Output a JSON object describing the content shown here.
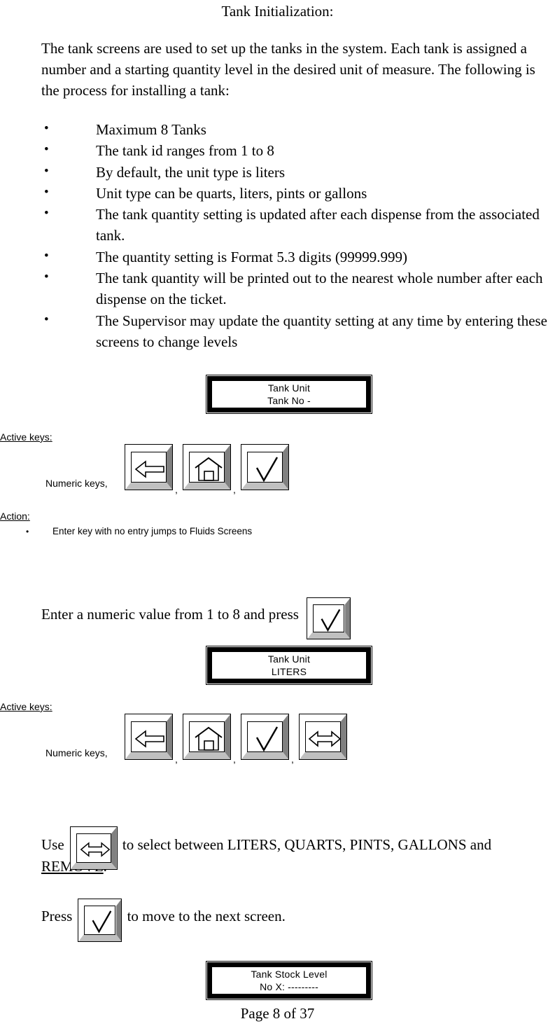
{
  "page": {
    "title": "Tank Initialization:",
    "intro": "The tank screens are used to set up the tanks in the system.  Each tank is assigned a number and a starting quantity level in the desired unit of measure.  The following is the process for installing a tank:",
    "footer": "Page 8 of 37"
  },
  "features": [
    "Maximum 8 Tanks",
    "The tank id ranges from 1 to 8",
    "By default, the unit type is liters",
    "Unit type can be quarts, liters, pints or gallons",
    "The tank quantity setting is updated after each dispense from the associated tank.",
    "The quantity setting is Format 5.3 digits (99999.999)",
    "The tank quantity will be printed out to the nearest whole number after each dispense on the ticket.",
    "The Supervisor may update the quantity setting at any time by entering these screens to change levels"
  ],
  "bullet_glyph": "•",
  "screens": {
    "tank_no": {
      "line1": "Tank Unit",
      "line2": "Tank No -"
    },
    "tank_unit": {
      "line1": "Tank Unit",
      "line2": "LITERS"
    },
    "tank_stock": {
      "line1": "Tank Stock Level",
      "line2": "No X: ---------"
    }
  },
  "sections": {
    "active_keys_label": "Active keys:",
    "action_label": "Action:",
    "numeric_keys_label": "Numeric keys,",
    "comma": ","
  },
  "action": {
    "bullet": "Enter key with no entry jumps to Fluids Screens"
  },
  "keys": {
    "back": "back-arrow-key",
    "home": "home-key",
    "enter": "enter-check-key",
    "select": "left-right-arrow-key"
  },
  "instructions": {
    "enter_numeric_before": "Enter a numeric value from 1 to 8 and press",
    "use_before": "Use",
    "use_after": " to select between LITERS, QUARTS, PINTS, GALLONS and ",
    "use_underlined": "REMOVE",
    "use_period": ".",
    "press_before": "Press",
    "press_after": " to move to the next screen."
  },
  "colors": {
    "bevel_light": "#ffffff",
    "bevel_mid": "#c0c0c0",
    "bevel_dark": "#808080",
    "ink": "#000000",
    "paper": "#ffffff"
  }
}
